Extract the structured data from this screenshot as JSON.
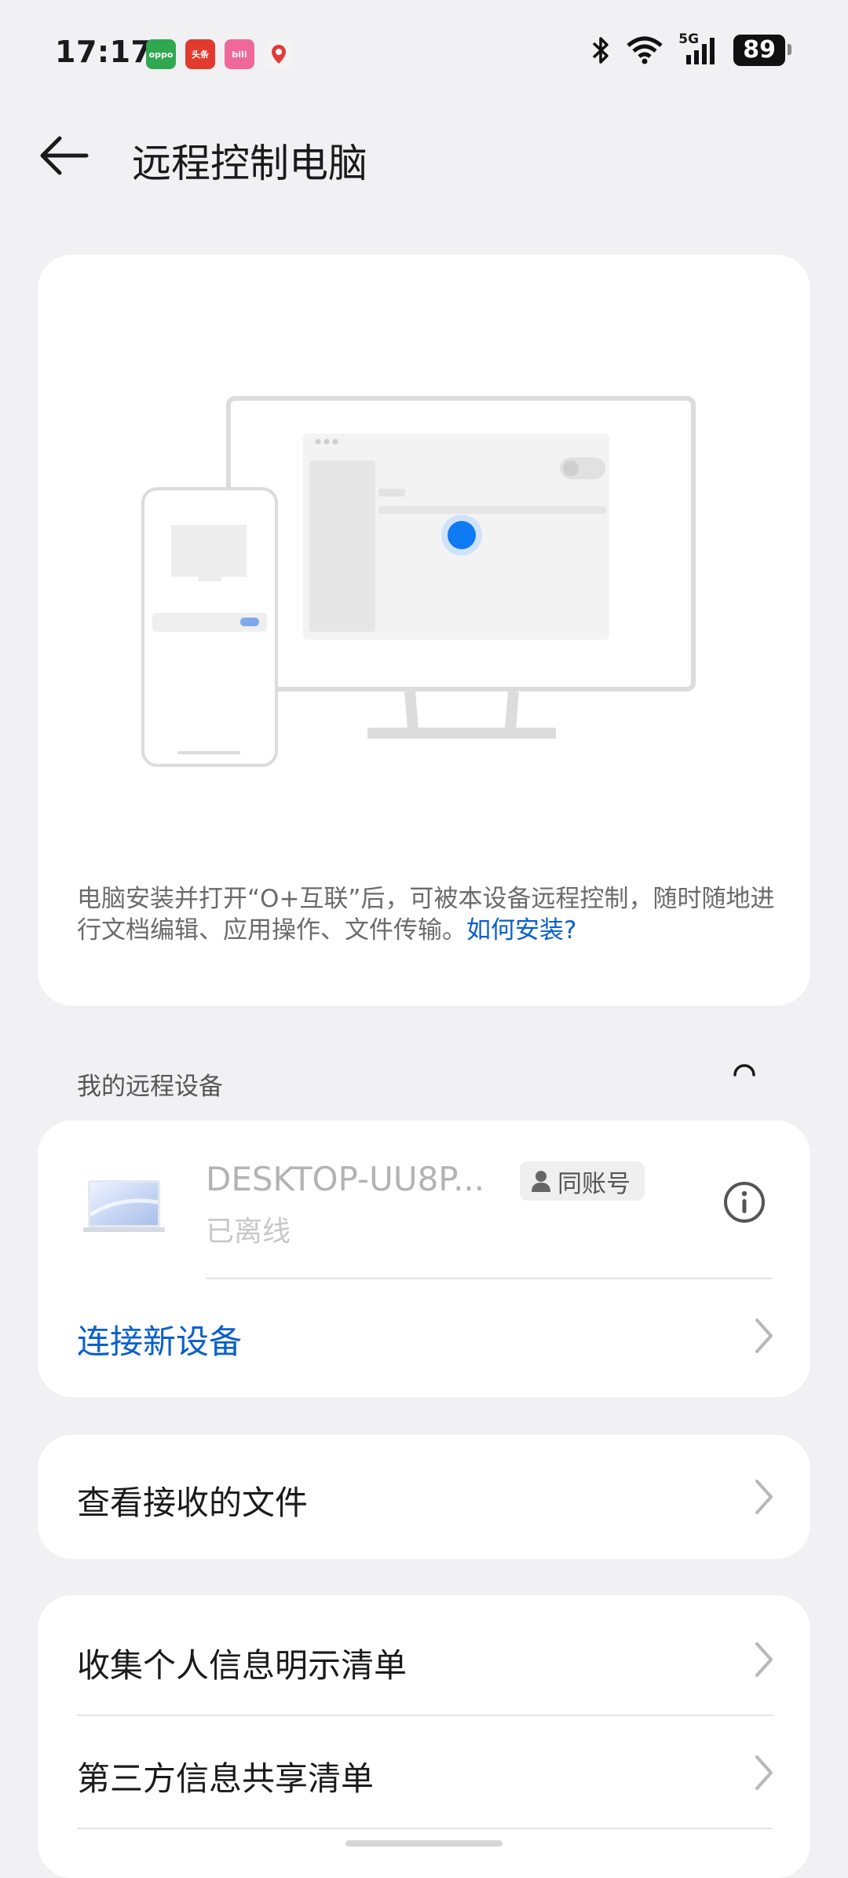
{
  "status_bar": {
    "time": "17:17",
    "battery": "89",
    "app_icons": [
      {
        "name": "oppo-app-icon",
        "text": "oppo",
        "color": "#2fa84f"
      },
      {
        "name": "toutiao-app-icon",
        "text": "头条",
        "color": "#e23a2e"
      },
      {
        "name": "bilibili-app-icon",
        "text": "bili",
        "color": "#f0689a"
      },
      {
        "name": "map-app-icon",
        "text": "du",
        "color": "#f3f3f3"
      }
    ],
    "network": "5G"
  },
  "header": {
    "back_icon": "arrow-left-icon",
    "title": "远程控制电脑"
  },
  "hero": {
    "desc": "电脑安装并打开“O+互联”后，可被本设备远程控制，随时随地进行文档编辑、应用操作、文件传输。",
    "link": "如何安装?"
  },
  "devices": {
    "section_label": "我的远程设备",
    "device_name": "DESKTOP-UU8P...",
    "badge": "同账号",
    "status": "已离线",
    "connect_label": "连接新设备"
  },
  "files": {
    "label": "查看接收的文件"
  },
  "privacy": {
    "items": [
      {
        "label": "收集个人信息明示清单"
      },
      {
        "label": "第三方信息共享清单"
      }
    ]
  },
  "colors": {
    "accent": "#0a5fcc",
    "background": "#f1f1f3",
    "card": "#ffffff"
  }
}
